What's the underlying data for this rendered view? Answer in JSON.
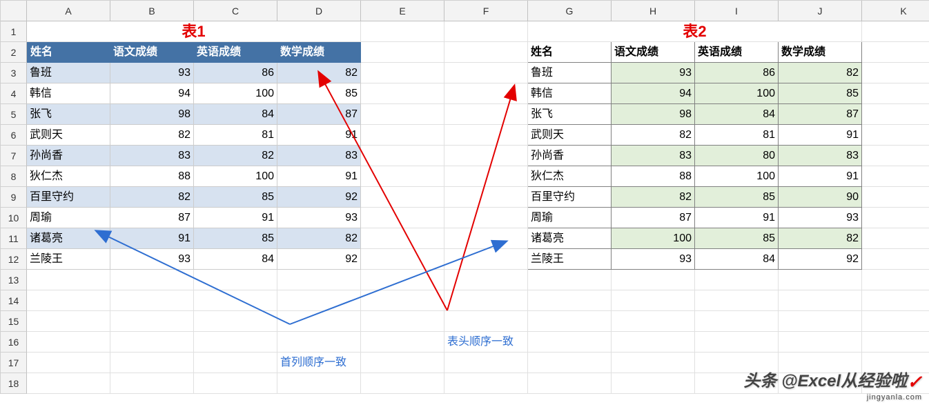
{
  "cols": [
    "A",
    "B",
    "C",
    "D",
    "E",
    "F",
    "G",
    "H",
    "I",
    "J",
    "K"
  ],
  "rows": [
    "1",
    "2",
    "3",
    "4",
    "5",
    "6",
    "7",
    "8",
    "9",
    "10",
    "11",
    "12",
    "13",
    "14",
    "15",
    "16",
    "17",
    "18"
  ],
  "title1": "表1",
  "title2": "表2",
  "t1_headers": [
    "姓名",
    "语文成绩",
    "英语成绩",
    "数学成绩"
  ],
  "t2_headers": [
    "姓名",
    "语文成绩",
    "英语成绩",
    "数学成绩"
  ],
  "chart_data": {
    "type": "table",
    "table1": {
      "columns": [
        "姓名",
        "语文成绩",
        "英语成绩",
        "数学成绩"
      ],
      "rows": [
        {
          "name": "鲁班",
          "yuwen": 93,
          "yingyu": 86,
          "shuxue": 82
        },
        {
          "name": "韩信",
          "yuwen": 94,
          "yingyu": 100,
          "shuxue": 85
        },
        {
          "name": "张飞",
          "yuwen": 98,
          "yingyu": 84,
          "shuxue": 87
        },
        {
          "name": "武则天",
          "yuwen": 82,
          "yingyu": 81,
          "shuxue": 91
        },
        {
          "name": "孙尚香",
          "yuwen": 83,
          "yingyu": 82,
          "shuxue": 83
        },
        {
          "name": "狄仁杰",
          "yuwen": 88,
          "yingyu": 100,
          "shuxue": 91
        },
        {
          "name": "百里守约",
          "yuwen": 82,
          "yingyu": 85,
          "shuxue": 92
        },
        {
          "name": "周瑜",
          "yuwen": 87,
          "yingyu": 91,
          "shuxue": 93
        },
        {
          "name": "诸葛亮",
          "yuwen": 91,
          "yingyu": 85,
          "shuxue": 82
        },
        {
          "name": "兰陵王",
          "yuwen": 93,
          "yingyu": 84,
          "shuxue": 92
        }
      ]
    },
    "table2": {
      "columns": [
        "姓名",
        "语文成绩",
        "英语成绩",
        "数学成绩"
      ],
      "rows": [
        {
          "name": "鲁班",
          "yuwen": 93,
          "yingyu": 86,
          "shuxue": 82
        },
        {
          "name": "韩信",
          "yuwen": 94,
          "yingyu": 100,
          "shuxue": 85
        },
        {
          "name": "张飞",
          "yuwen": 98,
          "yingyu": 84,
          "shuxue": 87
        },
        {
          "name": "武则天",
          "yuwen": 82,
          "yingyu": 81,
          "shuxue": 91
        },
        {
          "name": "孙尚香",
          "yuwen": 83,
          "yingyu": 80,
          "shuxue": 83
        },
        {
          "name": "狄仁杰",
          "yuwen": 88,
          "yingyu": 100,
          "shuxue": 91
        },
        {
          "name": "百里守约",
          "yuwen": 82,
          "yingyu": 85,
          "shuxue": 90
        },
        {
          "name": "周瑜",
          "yuwen": 87,
          "yingyu": 91,
          "shuxue": 93
        },
        {
          "name": "诸葛亮",
          "yuwen": 100,
          "yingyu": 85,
          "shuxue": 82
        },
        {
          "name": "兰陵王",
          "yuwen": 93,
          "yingyu": 84,
          "shuxue": 92
        }
      ]
    },
    "diff_shaded_cells_table2": [
      "H3:J3",
      "H4:J4",
      "H5:J5",
      "H7:J7",
      "H9:J9",
      "H11:J11"
    ]
  },
  "anno": {
    "header_same": "表头顺序一致",
    "firstcol_same": "首列顺序一致"
  },
  "watermark": {
    "main": "头条 @Excel从经验啦",
    "sub": "jingyanla.com"
  }
}
